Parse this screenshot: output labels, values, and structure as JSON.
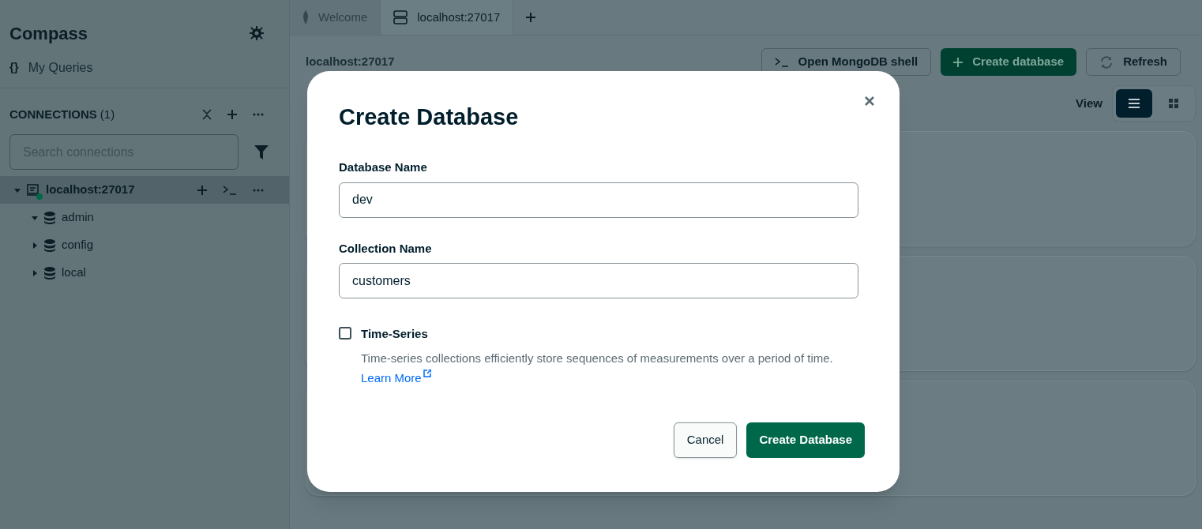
{
  "sidebar": {
    "title": "Compass",
    "my_queries_icon": "{}",
    "my_queries": "My Queries",
    "connections_label": "CONNECTIONS",
    "connections_count": "(1)",
    "search": {
      "placeholder": "Search connections"
    },
    "tree": [
      {
        "label": "localhost:27017",
        "expanded": true,
        "selected": true,
        "connected": true,
        "children": [
          {
            "label": "admin",
            "expanded": true,
            "selected": false
          },
          {
            "label": "config",
            "expanded": false,
            "selected": false
          },
          {
            "label": "local",
            "expanded": false,
            "selected": false
          }
        ]
      }
    ]
  },
  "tabs": [
    {
      "label": "Welcome",
      "kind": "welcome",
      "selected": false
    },
    {
      "label": "localhost:27017",
      "kind": "server",
      "selected": true
    }
  ],
  "header": {
    "title": "localhost:27017",
    "buttons": [
      {
        "label": "Open MongoDB shell",
        "kind": "shell"
      },
      {
        "label": "Create database",
        "kind": "primary"
      },
      {
        "label": "Refresh",
        "kind": "refresh"
      }
    ],
    "view_label": "View",
    "views": [
      {
        "kind": "list",
        "selected": true
      },
      {
        "kind": "grid",
        "selected": false
      }
    ]
  },
  "dialog": {
    "title": "Create Database",
    "fields": [
      {
        "label": "Database Name",
        "value": "dev"
      },
      {
        "label": "Collection Name",
        "value": "customers"
      }
    ],
    "timeseries": {
      "label": "Time-Series",
      "checked": false,
      "description": "Time-series collections efficiently store sequences of measurements over a period of time.",
      "link": "Learn More"
    },
    "cancel": "Cancel",
    "submit": "Create Database"
  }
}
